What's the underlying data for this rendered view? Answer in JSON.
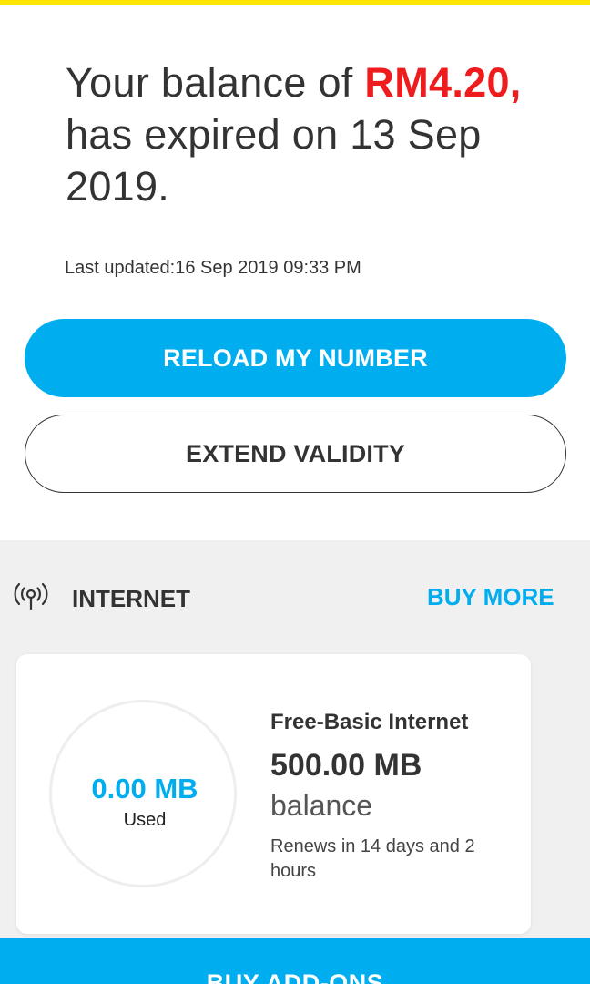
{
  "balance": {
    "prefix": "Your balance of ",
    "amount": "RM4.20,",
    "suffix": " has expired on 13 Sep 2019."
  },
  "last_updated": "Last updated:16 Sep 2019 09:33 PM",
  "buttons": {
    "reload": "RELOAD MY NUMBER",
    "extend": "EXTEND VALIDITY"
  },
  "internet": {
    "icon": "signal-broadcast-icon",
    "title": "INTERNET",
    "buy_more": "BUY MORE",
    "plan": {
      "used_value": "0.00 MB",
      "used_label": "Used",
      "name": "Free-Basic Internet",
      "amount": "500.00 MB",
      "balance_label": "balance",
      "renews": "Renews in 14 days and 2 hours"
    }
  },
  "bottom_action": "BUY ADD-ONS",
  "colors": {
    "accent_yellow": "#ffe500",
    "primary_blue": "#00aeef",
    "expired_red": "#ee1c1c",
    "section_grey": "#f0f0f0"
  }
}
